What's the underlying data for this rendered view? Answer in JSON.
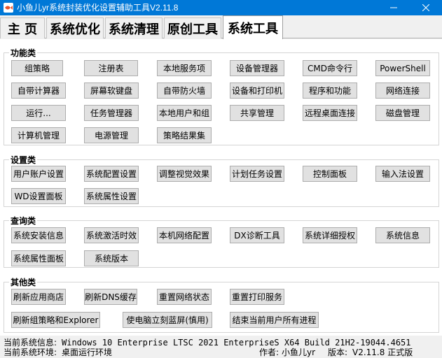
{
  "window": {
    "title": "小鱼儿yr系统封装优化设置辅助工具V2.11.8"
  },
  "tabs": [
    "主 页",
    "系统优化",
    "系统清理",
    "原创工具",
    "系统工具"
  ],
  "active_tab": "系统工具",
  "groups": {
    "functions": {
      "title": "功能类",
      "buttons": [
        "组策略",
        "注册表",
        "本地服务项",
        "设备管理器",
        "CMD命令行",
        "PowerShell",
        "自带计算器",
        "屏幕软键盘",
        "自带防火墙",
        "设备和打印机",
        "程序和功能",
        "网络连接",
        "运行...",
        "任务管理器",
        "本地用户和组",
        "共享管理",
        "远程桌面连接",
        "磁盘管理",
        "计算机管理",
        "电源管理",
        "策略结果集"
      ]
    },
    "settings": {
      "title": "设置类",
      "buttons": [
        "用户账户设置",
        "系统配置设置",
        "调整视觉效果",
        "计划任务设置",
        "控制面板",
        "输入法设置",
        "WD设置面板",
        "系统属性设置"
      ]
    },
    "query": {
      "title": "查询类",
      "buttons": [
        "系统安装信息",
        "系统激活时效",
        "本机网络配置",
        "DX诊断工具",
        "系统详细授权",
        "系统信息",
        "系统属性面板",
        "系统版本"
      ]
    },
    "other": {
      "title": "其他类",
      "buttons": [
        "刷新应用商店",
        "刷新DNS缓存",
        "重置网络状态",
        "重置打印服务",
        "刷新组策略和Explorer",
        "使电脑立刻蓝屏(慎用)",
        "结束当前用户所有进程"
      ]
    }
  },
  "status": {
    "sysinfo_label": "当前系统信息:",
    "sysinfo_value": "Windows 10 Enterprise LTSC 2021 EnterpriseS X64 Build 21H2-19044.4651",
    "env_label": "当前系统环境:",
    "env_value": "桌面运行环境",
    "author_label": "作者:",
    "author_value": "小鱼儿yr",
    "version_label": "版本:",
    "version_value": "V2.11.8 正式版"
  },
  "colors": {
    "titlebar": "#0078d7",
    "button_bg": "#e1e1e1",
    "button_border": "#adadad"
  },
  "icons": {
    "app": "fish-app-icon",
    "minimize": "minimize-icon",
    "maximize": "maximize-icon",
    "close": "close-icon"
  }
}
